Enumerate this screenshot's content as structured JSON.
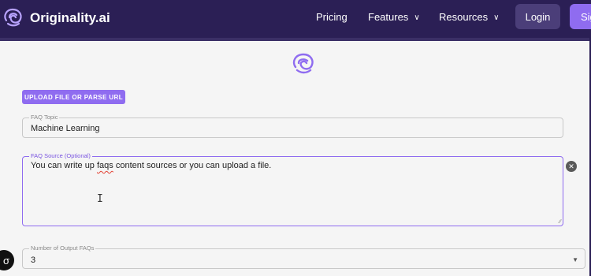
{
  "header": {
    "brand": "Originality.ai",
    "nav": {
      "pricing": "Pricing",
      "features": "Features",
      "resources": "Resources"
    },
    "login": "Login",
    "signup": "Sig"
  },
  "form": {
    "upload_button": "UPLOAD FILE OR PARSE URL",
    "topic": {
      "label": "FAQ Topic",
      "value": "Machine Learning"
    },
    "source": {
      "label": "FAQ Source (Optional)",
      "value_before": "You can write up ",
      "value_misspelled": "faqs",
      "value_after": " content sources or you can upload a file."
    },
    "output_count": {
      "label": "Number of Output FAQs",
      "value": "3"
    }
  },
  "colors": {
    "nav_bg": "#2b1f55",
    "accent": "#8f6cf0",
    "login_bg": "#4b3e79"
  },
  "icons": {
    "logo": "brain-icon",
    "clear": "close-circle-icon",
    "dropdown": "caret-down-icon"
  }
}
